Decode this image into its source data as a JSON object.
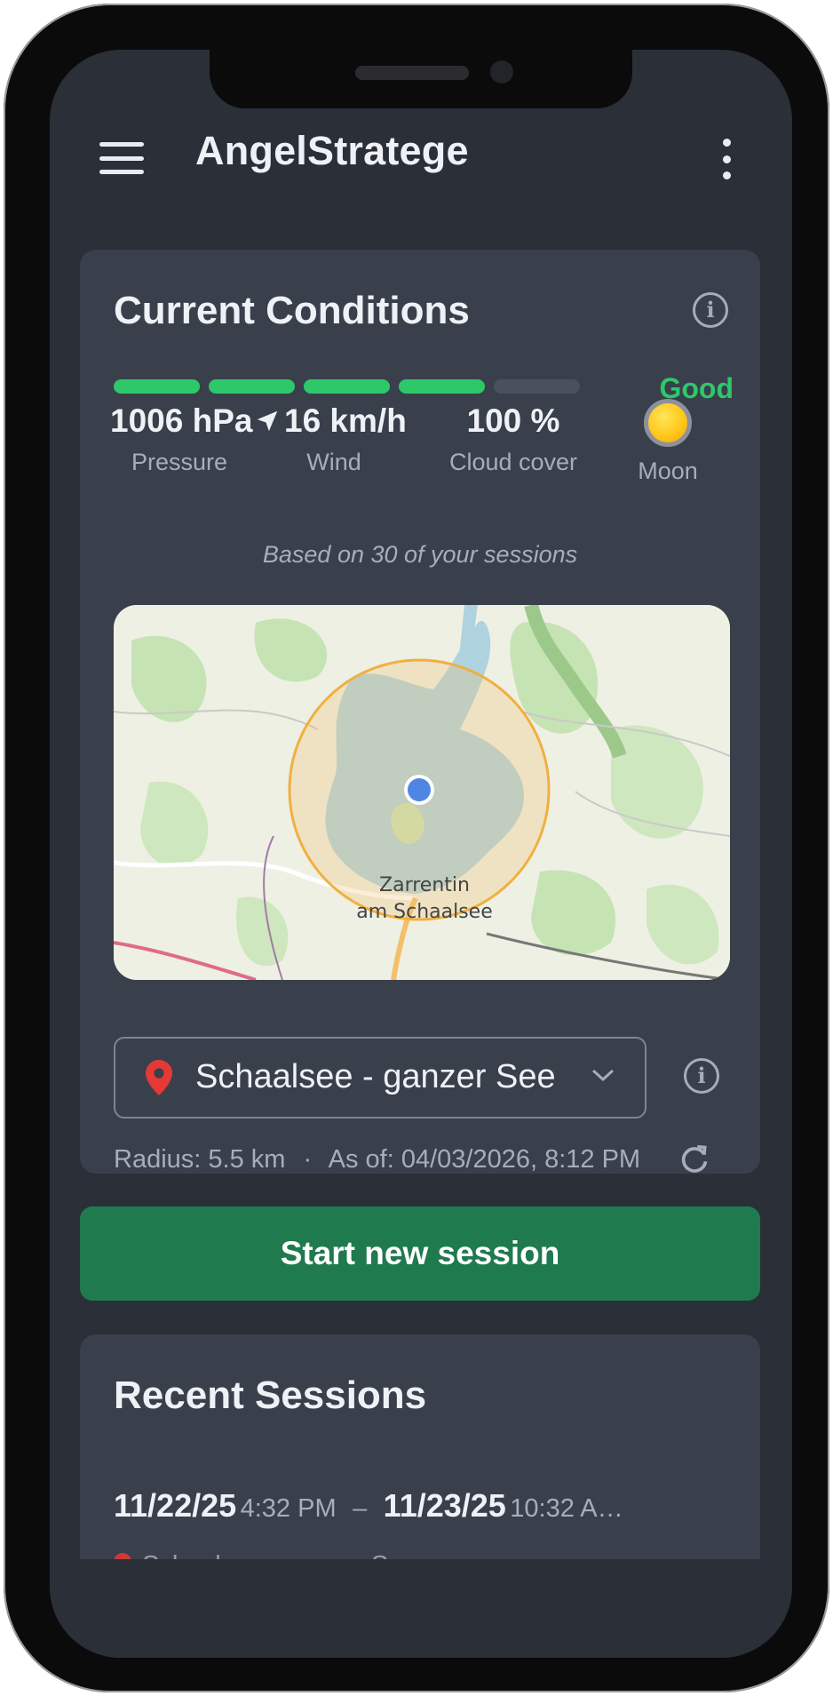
{
  "app": {
    "title": "AngelStratege"
  },
  "icons": {
    "menu": "hamburger-menu-icon",
    "more": "more-vertical-icon",
    "info": "info-icon",
    "pin": "location-pin-icon",
    "wind": "wind-arrow-icon",
    "refresh": "refresh-icon",
    "dropdown": "chevron-down-icon"
  },
  "conditions": {
    "title": "Current Conditions",
    "rating": {
      "label": "Good",
      "filled": 4,
      "total": 5,
      "color": "#2ec76a",
      "empty_color": "#4a515c"
    },
    "stats": {
      "pressure": {
        "value": "1006 hPa",
        "label": "Pressure"
      },
      "wind": {
        "value": "16 km/h",
        "label": "Wind"
      },
      "cloud": {
        "value": "100 %",
        "label": "Cloud cover"
      },
      "moon": {
        "label": "Moon"
      }
    },
    "note": "Based on 30 of your sessions",
    "map": {
      "town_line1": "Zarrentin",
      "town_line2": "am Schaalsee"
    },
    "location": {
      "selected": "Schaalsee - ganzer See"
    },
    "radius": "Radius: 5.5 km",
    "separator": "·",
    "as_of": "As of: 04/03/2026, 8:12 PM"
  },
  "actions": {
    "start_session": "Start new session"
  },
  "recent": {
    "title": "Recent Sessions",
    "sessions": [
      {
        "start_date": "11/22/25",
        "start_time": "4:32 PM",
        "dash": "–",
        "end_date": "11/23/25",
        "end_time": "10:32 A…",
        "location": "Schaalsee - ganzer See"
      }
    ]
  },
  "colors": {
    "background": "#2a2f38",
    "card": "#39404b",
    "accent_green": "#1f7a4e",
    "pin_red": "#e53935"
  }
}
